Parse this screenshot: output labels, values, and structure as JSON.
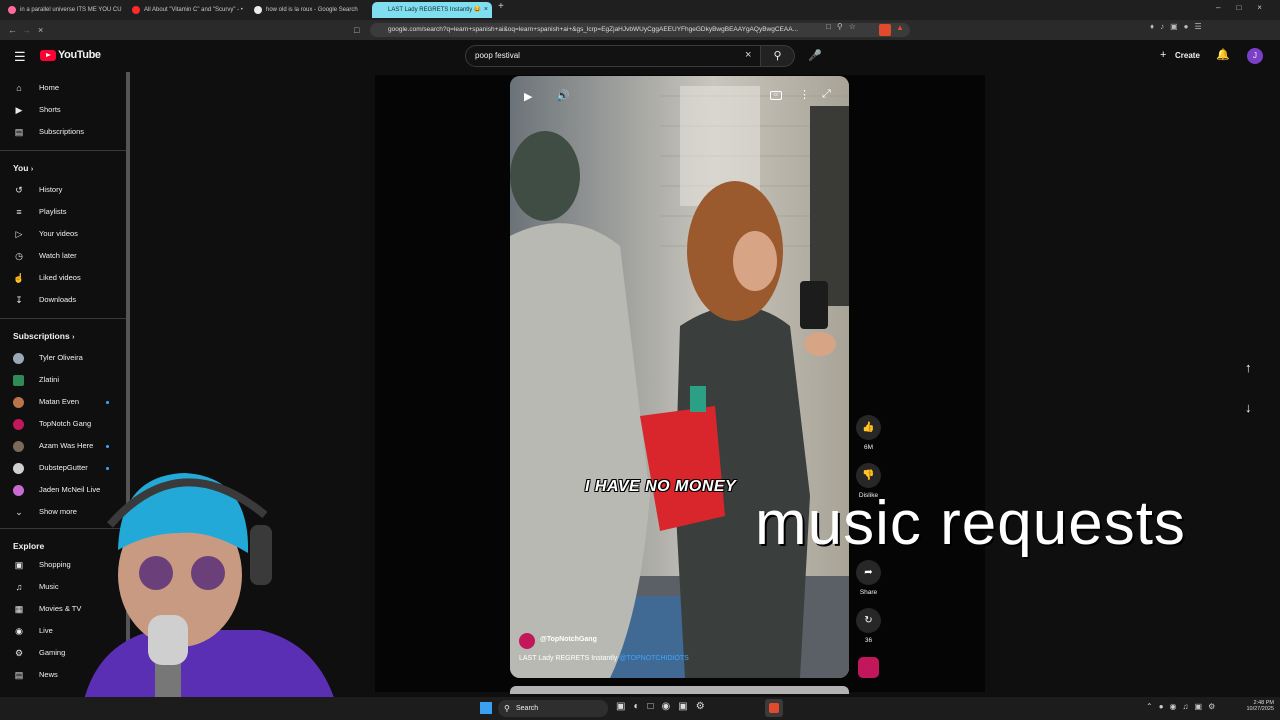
{
  "browser": {
    "tabs": [
      {
        "label": "in a parallel universe ITS ME YOU CU",
        "fav": "#ff6b9c"
      },
      {
        "label": "All About \"Vitamin C\" and \"Scurvy\" - •",
        "fav": "#ff2a2a"
      },
      {
        "label": "how old is la roux - Google Search",
        "fav": "#eaeaea"
      },
      {
        "label": "LAST Lady REGRETS Instantly 😂",
        "fav": "#ff2a2a"
      }
    ],
    "new_tab": "+",
    "url": "google.com/search?q=learn+spanish+ai&oq=learn+spanish+ai+&gs_lcrp=EgZjaHJvbWUyCggAEEUYFhgeGDkyBwgBEAAYgAQyBwgCEAA...",
    "close_tab": "×"
  },
  "yt": {
    "logo_text": "YouTube",
    "search_value": "poop festival",
    "create_label": "Create",
    "avatar_letter": "J",
    "accent": "#ff0033"
  },
  "sidebar": {
    "top": [
      {
        "label": "Home",
        "icon": "home-icon"
      },
      {
        "label": "Shorts",
        "icon": "shorts-icon"
      },
      {
        "label": "Subscriptions",
        "icon": "subscriptions-icon"
      }
    ],
    "you_header": "You",
    "you": [
      {
        "label": "History",
        "icon": "history-icon"
      },
      {
        "label": "Playlists",
        "icon": "playlists-icon"
      },
      {
        "label": "Your videos",
        "icon": "your-videos-icon"
      },
      {
        "label": "Watch later",
        "icon": "clock-icon"
      },
      {
        "label": "Liked videos",
        "icon": "thumbs-up-icon"
      },
      {
        "label": "Downloads",
        "icon": "download-icon"
      }
    ],
    "subs_header": "Subscriptions",
    "subs": [
      {
        "label": "Tyler Oliveira",
        "color": "#9aa8b5",
        "dot": false
      },
      {
        "label": "Zlatini",
        "color": "#2e8b57",
        "dot": false
      },
      {
        "label": "Matan Even",
        "color": "#b8744a",
        "dot": true
      },
      {
        "label": "TopNotch Gang",
        "color": "#c2185b",
        "dot": false
      },
      {
        "label": "Azam Was Here",
        "color": "#7a6a58",
        "dot": true
      },
      {
        "label": "DubstepGutter",
        "color": "#d0d0d0",
        "dot": true
      },
      {
        "label": "Jaden McNeil Live",
        "color": "#c86bd0",
        "dot": false
      }
    ],
    "show_more": "Show more",
    "explore_header": "Explore",
    "explore": [
      {
        "label": "Shopping",
        "icon": "shopping-icon"
      },
      {
        "label": "Music",
        "icon": "music-icon"
      },
      {
        "label": "Movies & TV",
        "icon": "film-icon"
      },
      {
        "label": "Live",
        "icon": "live-icon"
      },
      {
        "label": "Gaming",
        "icon": "gaming-icon"
      },
      {
        "label": "News",
        "icon": "news-icon"
      }
    ]
  },
  "short": {
    "caption": "I HAVE NO MONEY",
    "channel": "@TopNotchGang",
    "title": "LAST Lady REGRETS Instantly",
    "title_handle": "@TOPNOTCHIDIOTS",
    "like_count": "6M",
    "dislike_label": "Dislike",
    "share_label": "Share",
    "remix_count": "36"
  },
  "overlay": {
    "text": "music requests"
  },
  "taskbar": {
    "search_label": "Search",
    "time": "2:48 PM",
    "date": "10/27/2025"
  }
}
